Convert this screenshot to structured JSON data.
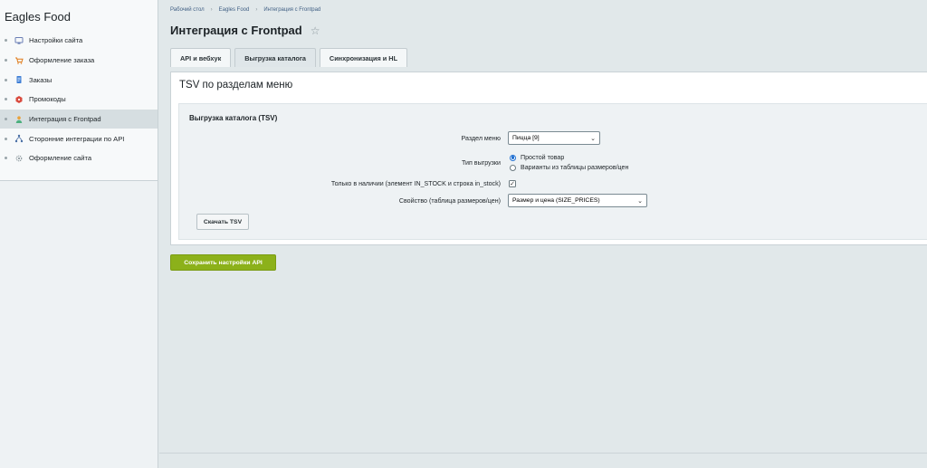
{
  "sidebar": {
    "site_title": "Eagles Food",
    "items": [
      {
        "label": "Настройки сайта",
        "icon": "monitor-icon",
        "active": false
      },
      {
        "label": "Оформление заказа",
        "icon": "cart-icon",
        "active": false
      },
      {
        "label": "Заказы",
        "icon": "document-icon",
        "active": false
      },
      {
        "label": "Промокоды",
        "icon": "tag-icon",
        "active": false
      },
      {
        "label": "Интеграция с Frontpad",
        "icon": "person-icon",
        "active": true
      },
      {
        "label": "Сторонние интеграции по API",
        "icon": "network-icon",
        "active": false
      },
      {
        "label": "Оформление сайта",
        "icon": "gear-icon",
        "active": false
      }
    ]
  },
  "breadcrumb": [
    "Рабочий стол",
    "Eagles Food",
    "Интеграция с Frontpad"
  ],
  "page_title": "Интеграция с Frontpad",
  "tabs": [
    {
      "label": "API и вебхук",
      "active": false
    },
    {
      "label": "Выгрузка каталога",
      "active": true
    },
    {
      "label": "Синхронизация и HL",
      "active": false
    }
  ],
  "panel": {
    "title": "TSV по разделам меню",
    "section_title": "Выгрузка каталога (TSV)",
    "menu_section_label": "Раздел меню",
    "menu_section_value": "Пицца [9]",
    "export_type_label": "Тип выгрузки",
    "export_type_options": [
      "Простой товар",
      "Варианты из таблицы размеров/цен"
    ],
    "export_type_selected": 0,
    "in_stock_label": "Только в наличии (элемент IN_STOCK и строка in_stock)",
    "in_stock_checked": true,
    "property_label": "Свойство (таблица размеров/цен)",
    "property_value": "Размер и цена (SIZE_PRICES)",
    "download_button": "Скачать TSV"
  },
  "save_button": "Сохранить настройки API",
  "colors": {
    "accent_green": "#8cb11a",
    "link_blue": "#3f5e83",
    "radio_blue": "#1f6fd1"
  }
}
